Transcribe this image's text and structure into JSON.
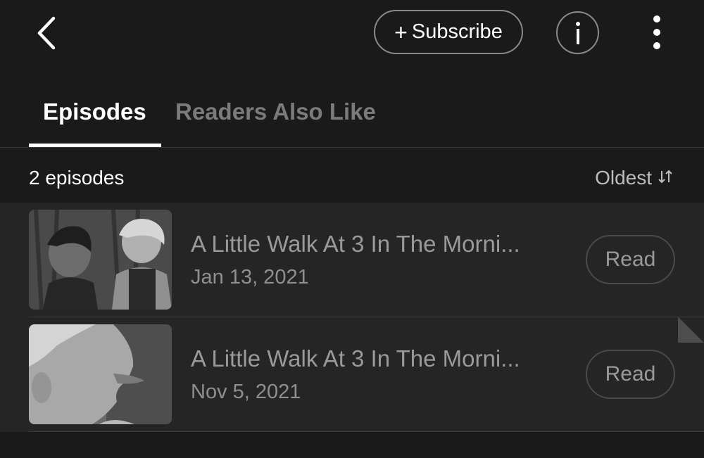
{
  "header": {
    "subscribe_label": "Subscribe",
    "subscribe_plus": "+",
    "info_label": "i"
  },
  "tabs": [
    {
      "label": "Episodes",
      "active": true
    },
    {
      "label": "Readers Also Like",
      "active": false
    }
  ],
  "episodes_header": {
    "count": "2 episodes",
    "sort_label": "Oldest"
  },
  "episodes": [
    {
      "title": "A Little Walk At 3 In The Morni...",
      "date": "Jan 13, 2021",
      "read_label": "Read"
    },
    {
      "title": "A Little Walk At 3 In The Morni...",
      "date": "Nov 5, 2021",
      "read_label": "Read"
    }
  ],
  "colors": {
    "background": "#1a1a1a",
    "list_background": "#252525",
    "active_tab": "#ffffff",
    "inactive_tab": "#7b7b7b"
  },
  "icons": [
    "chevron-left-icon",
    "plus-icon",
    "info-icon",
    "more-vertical-icon",
    "sort-icon"
  ]
}
